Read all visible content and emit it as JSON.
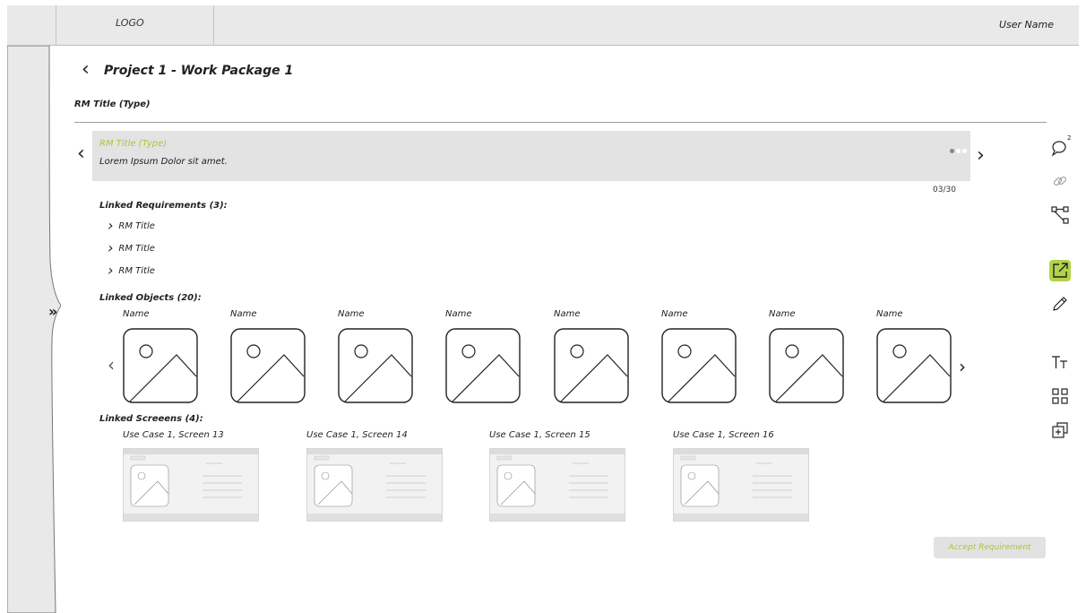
{
  "header": {
    "logo": "LOGO",
    "user_name": "User Name"
  },
  "page": {
    "title": "Project 1 - Work Package 1",
    "subtitle": "RM Title (Type)"
  },
  "requirement": {
    "title": "RM Title (Type)",
    "description": "Lorem Ipsum Dolor sit amet.",
    "counter": "03/30"
  },
  "linked_requirements": {
    "label": "Linked Requirements (3):",
    "items": [
      "RM Title",
      "RM Title",
      "RM Title"
    ]
  },
  "linked_objects": {
    "label": "Linked Objects (20):",
    "items": [
      "Name",
      "Name",
      "Name",
      "Name",
      "Name",
      "Name",
      "Name",
      "Name"
    ]
  },
  "linked_screens": {
    "label": "Linked Screeens (4):",
    "items": [
      "Use Case 1, Screen 13",
      "Use Case 1, Screen 14",
      "Use Case 1, Screen 15",
      "Use Case 1, Screen 16"
    ]
  },
  "toolbar": {
    "comment_count": "2",
    "icons": [
      "comment-icon",
      "link-icon",
      "hierarchy-icon",
      "external-link-icon",
      "edit-icon",
      "text-size-icon",
      "grid-icon",
      "add-layer-icon"
    ]
  },
  "actions": {
    "accept_label": "Accept Requirement"
  },
  "colors": {
    "accent": "#b4d34a",
    "card_bg": "#e3e3e3",
    "topbar_bg": "#e9e9e9"
  }
}
